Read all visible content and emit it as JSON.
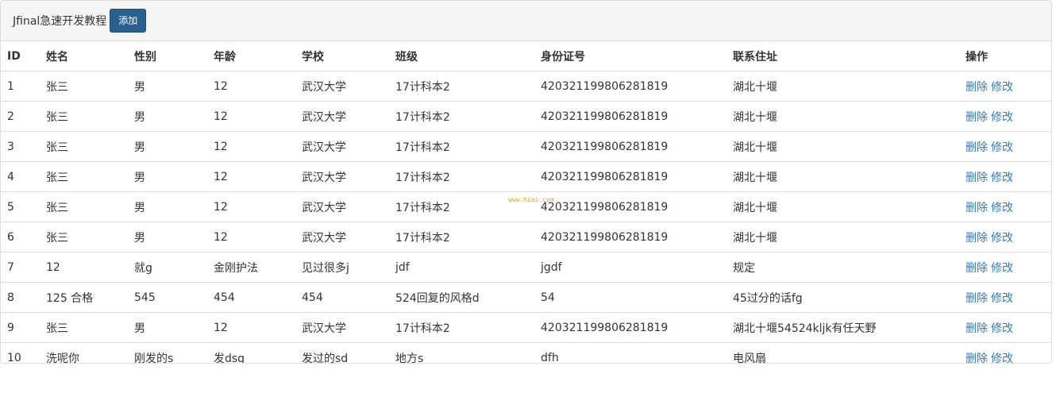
{
  "header": {
    "title": "Jfinal急速开发教程",
    "add_label": "添加"
  },
  "table": {
    "columns": [
      "ID",
      "姓名",
      "性别",
      "年龄",
      "学校",
      "班级",
      "身份证号",
      "联系住址",
      "操作"
    ],
    "rows": [
      {
        "id": "1",
        "name": "张三",
        "gender": "男",
        "age": "12",
        "school": "武汉大学",
        "class": "17计科本2",
        "idcard": "420321199806281819",
        "address": "湖北十堰"
      },
      {
        "id": "2",
        "name": "张三",
        "gender": "男",
        "age": "12",
        "school": "武汉大学",
        "class": "17计科本2",
        "idcard": "420321199806281819",
        "address": "湖北十堰"
      },
      {
        "id": "3",
        "name": "张三",
        "gender": "男",
        "age": "12",
        "school": "武汉大学",
        "class": "17计科本2",
        "idcard": "420321199806281819",
        "address": "湖北十堰"
      },
      {
        "id": "4",
        "name": "张三",
        "gender": "男",
        "age": "12",
        "school": "武汉大学",
        "class": "17计科本2",
        "idcard": "420321199806281819",
        "address": "湖北十堰"
      },
      {
        "id": "5",
        "name": "张三",
        "gender": "男",
        "age": "12",
        "school": "武汉大学",
        "class": "17计科本2",
        "idcard": "420321199806281819",
        "address": "湖北十堰"
      },
      {
        "id": "6",
        "name": "张三",
        "gender": "男",
        "age": "12",
        "school": "武汉大学",
        "class": "17计科本2",
        "idcard": "420321199806281819",
        "address": "湖北十堰"
      },
      {
        "id": "7",
        "name": "12",
        "gender": "就g",
        "age": "金刚护法",
        "school": "见过很多j",
        "class": "jdf",
        "idcard": "jgdf",
        "address": "规定"
      },
      {
        "id": "8",
        "name": "125 合格",
        "gender": "545",
        "age": "454",
        "school": "454",
        "class": "524回复的风格d",
        "idcard": "54",
        "address": "45过分的话fg"
      },
      {
        "id": "9",
        "name": "张三",
        "gender": "男",
        "age": "12",
        "school": "武汉大学",
        "class": "17计科本2",
        "idcard": "420321199806281819",
        "address": "湖北十堰54524kljk有任天野"
      },
      {
        "id": "10",
        "name": "洗呢你",
        "gender": "刚发的s",
        "age": "发dsg",
        "school": "发过的sd",
        "class": "地方s",
        "idcard": "dfh",
        "address": "电风扇"
      }
    ],
    "delete_label": "删除",
    "edit_label": "修改"
  },
  "watermark": "www.hiai.com",
  "colors": {
    "add_button": "#286090",
    "link": "#337ab7",
    "heading_bg": "#f5f5f5"
  }
}
